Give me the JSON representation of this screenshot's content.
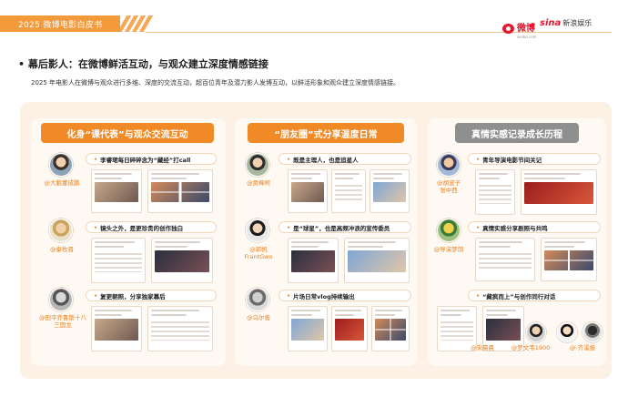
{
  "header": {
    "report_title": "2025 微博电影白皮书",
    "weibo_logo": "微博",
    "weibo_logo_sub": "weibo.com",
    "sina_logo_mark": "sina",
    "sina_logo_text": "新浪娱乐"
  },
  "section": {
    "title": "幕后影人：在微博鲜活互动，与观众建立深度情感链接",
    "description": "2025 年电影人在微博与观众进行多维、深度的交流互动，超百位青年及潜力影人发博互动，以鲜活形象和观众建立深度情感链接。"
  },
  "panels": [
    {
      "title": "化身“课代表”与观众交流互动",
      "rows": [
        {
          "quote": "李睿珺每日碎碎念为“藏经”打call",
          "handle": "@大鹏董成鹏"
        },
        {
          "quote": "镜头之外，是更珍贵的创作独白",
          "handle": "@秦牧晋"
        },
        {
          "quote": "复更朝照，分享独家幕后",
          "handle": "@田平乔鲁斯十八\n三国龙"
        }
      ]
    },
    {
      "title": "“朋友圈”式分享温度日常",
      "rows": [
        {
          "quote": "既是主理人，也是追星人",
          "handle": "@贾樟柯"
        },
        {
          "quote": "是“球星”，也是高频冲浪的宣传委员",
          "handle": "@郭帆\nFrantGwo"
        },
        {
          "quote": "片场日常vlog持续输出",
          "handle": "@乌尔善"
        }
      ]
    },
    {
      "title": "真情实感记录成长历程",
      "rows": [
        {
          "quote": "青年导演电影节间关记",
          "handle": "@胡波子\n张中西"
        },
        {
          "quote": "真情实感分享剧照与共鸣",
          "handle": "@导演梦鸽"
        },
        {
          "quote": "“藏疯而上”与创作同行对话",
          "handle": ""
        }
      ],
      "bottom_handles": [
        "@宋晨晨",
        "@罗文韦1900",
        "@-齐溪报"
      ]
    }
  ],
  "colors": {
    "accent": "#f08a27",
    "grey_tag": "#8f8f8f",
    "bg_panel": "#fdf1e5"
  }
}
